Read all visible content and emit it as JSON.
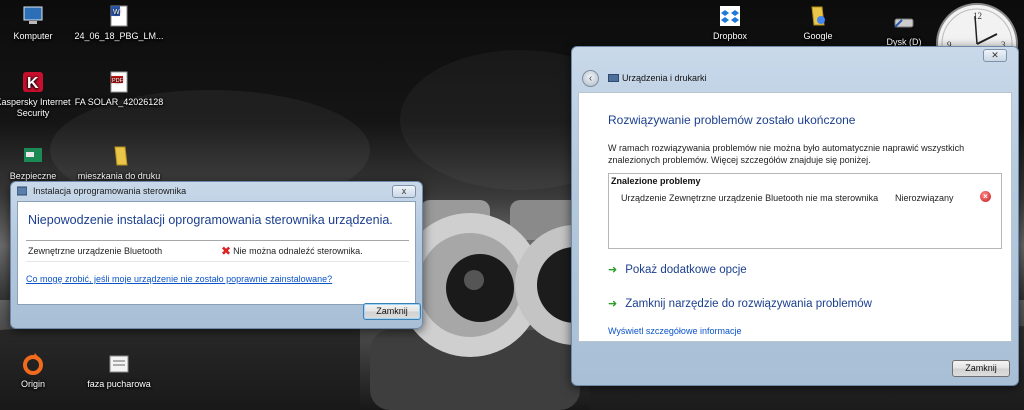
{
  "desktop": {
    "icons_left": [
      {
        "label": "Komputer",
        "icon": "computer-icon"
      },
      {
        "label": "24_06_18_PBG_LM...",
        "icon": "word-document-icon"
      },
      {
        "label": "Kaspersky Internet Security",
        "icon": "kaspersky-icon"
      },
      {
        "label": "FA SOLAR_42026128",
        "icon": "pdf-icon"
      },
      {
        "label": "Bezpieczne",
        "icon": "shortcut-icon"
      },
      {
        "label": "mieszkania do druku",
        "icon": "folder-icon"
      },
      {
        "label": "Origin",
        "icon": "origin-icon"
      },
      {
        "label": "faza pucharowa",
        "icon": "document-icon"
      }
    ],
    "icons_right": [
      {
        "label": "Dropbox",
        "icon": "dropbox-icon"
      },
      {
        "label": "Google",
        "icon": "google-shortcut-icon"
      },
      {
        "label": "Dysk (D)",
        "icon": "drive-icon"
      }
    ]
  },
  "driver_window": {
    "title": "Instalacja oprogramowania sterownika",
    "close": "x",
    "heading": "Niepowodzenie instalacji oprogramowania sterownika urządzenia.",
    "device": "Zewnętrzne urządzenie Bluetooth",
    "error": "Nie można odnaleźć sterownika.",
    "help_link": "Co mogę zrobić, jeśli moje urządzenie nie zostało poprawnie zainstalowane?",
    "close_button": "Zamknij"
  },
  "trouble_window": {
    "breadcrumb": "Urządzenia i drukarki",
    "heading": "Rozwiązywanie problemów zostało ukończone",
    "description": "W ramach rozwiązywania problemów nie można było automatycznie naprawić wszystkich znalezionych problemów. Więcej szczegółów znajduje się poniżej.",
    "found_title": "Znalezione problemy",
    "problem": "Urządzenie Zewnętrzne urządzenie Bluetooth nie ma sterownika",
    "status": "Nierozwiązany",
    "option_1": "Pokaż dodatkowe opcje",
    "option_2": "Zamknij narzędzie do rozwiązywania problemów",
    "details_link": "Wyświetl szczegółowe informacje",
    "close_button": "Zamknij"
  },
  "colors": {
    "heading_blue": "#1b3f8f",
    "link_blue": "#0a53c9",
    "arrow_green": "#2a9d2a",
    "error_red": "#d22222"
  }
}
